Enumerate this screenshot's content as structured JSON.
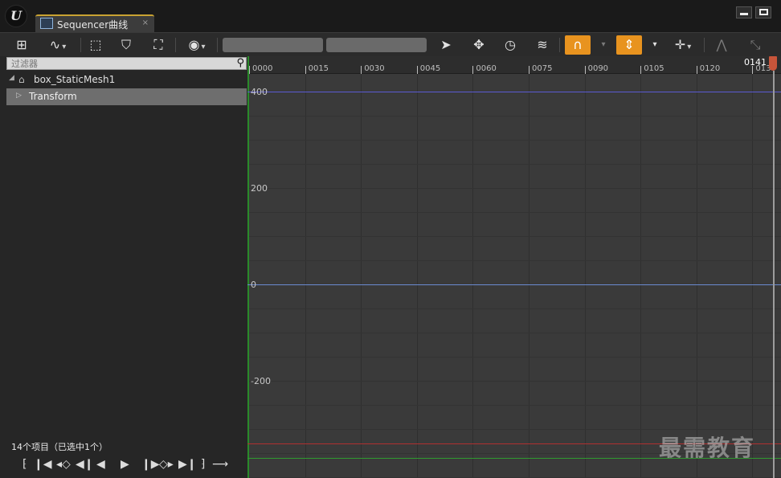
{
  "window": {
    "tab_title": "Sequencer曲线",
    "tab_close": "×"
  },
  "toolbar": {
    "icons": [
      "add-key-icon",
      "curve-icon",
      "select-all-keys-icon",
      "select-keys-icon",
      "frame-selection-icon",
      "visibility-eye-icon",
      "select-tool-icon",
      "move-tool-icon",
      "time-snap-icon",
      "curve-normalize-icon",
      "magnet-snap-icon",
      "value-snap-icon",
      "transform-move-icon",
      "tangent-weighted-icon",
      "tangent-break-icon"
    ],
    "active_color": "#e8931f"
  },
  "search": {
    "placeholder": "过滤器"
  },
  "tree": {
    "root_label": "box_StaticMesh1",
    "child_label": "Transform"
  },
  "status_text": "14个项目（已选中1个）",
  "ruler": {
    "ticks": [
      "0000",
      "0015",
      "0030",
      "0045",
      "0060",
      "0075",
      "0090",
      "0105",
      "0120",
      "013"
    ],
    "playhead_frame": "0141"
  },
  "y_axis": {
    "labels": [
      "400",
      "200",
      "0",
      "-200"
    ]
  },
  "curves": {
    "blue_color": "#5a5ad2",
    "axis_blue_color": "#6a8ad0",
    "red_color": "#b03030",
    "green_color": "#2f9a2f"
  },
  "watermark": "最需教育"
}
